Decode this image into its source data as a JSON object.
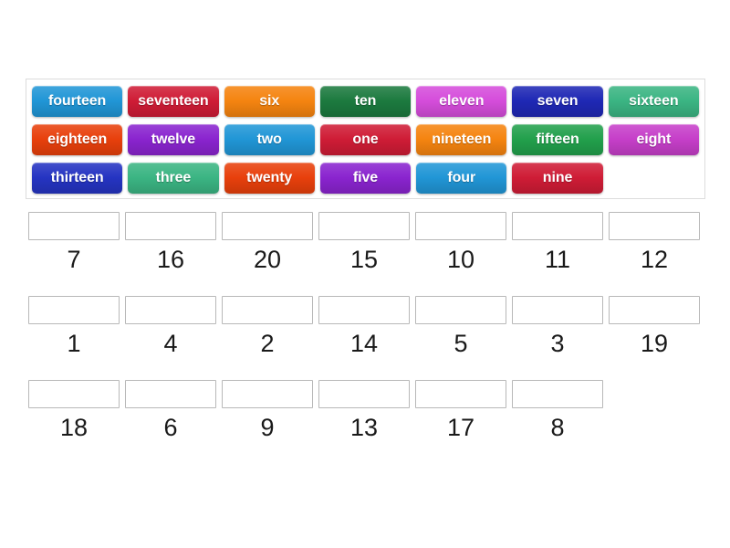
{
  "activity": {
    "type": "match-up-word-to-number",
    "title": "Number words matching activity"
  },
  "tile_bank": {
    "name": "word-tile-bank",
    "rows": [
      [
        {
          "label": "fourteen",
          "color": "#2196d6"
        },
        {
          "label": "seventeen",
          "color": "#cf1c36"
        },
        {
          "label": "six",
          "color": "#f58410"
        },
        {
          "label": "ten",
          "color": "#1c7a3f"
        },
        {
          "label": "eleven",
          "color": "#d54ddb"
        },
        {
          "label": "seven",
          "color": "#1f28b5"
        },
        {
          "label": "sixteen",
          "color": "#3bb583"
        }
      ],
      [
        {
          "label": "eighteen",
          "color": "#e8400c"
        },
        {
          "label": "twelve",
          "color": "#8a24cf"
        },
        {
          "label": "two",
          "color": "#2196d6"
        },
        {
          "label": "one",
          "color": "#cf1c36"
        },
        {
          "label": "nineteen",
          "color": "#f58410"
        },
        {
          "label": "fifteen",
          "color": "#22a04c"
        },
        {
          "label": "eight",
          "color": "#c63fc9"
        }
      ],
      [
        {
          "label": "thirteen",
          "color": "#2534c2"
        },
        {
          "label": "three",
          "color": "#3bb583"
        },
        {
          "label": "twenty",
          "color": "#e8400c"
        },
        {
          "label": "five",
          "color": "#8a24cf"
        },
        {
          "label": "four",
          "color": "#2196d6"
        },
        {
          "label": "nine",
          "color": "#cf1c36"
        },
        {
          "label": "",
          "color": "",
          "empty": true
        }
      ]
    ]
  },
  "answer_area": {
    "name": "numeral-answer-rows",
    "drop_zone_value": "",
    "rows": [
      {
        "labels": [
          "7",
          "16",
          "20",
          "15",
          "10",
          "11",
          "12"
        ]
      },
      {
        "labels": [
          "1",
          "4",
          "2",
          "14",
          "5",
          "3",
          "19"
        ]
      },
      {
        "labels": [
          "18",
          "6",
          "9",
          "13",
          "17",
          "8"
        ]
      }
    ]
  },
  "style": {
    "page_background": "#ffffff",
    "bank_border": "#dcdcdc",
    "dropbox_border": "#b8b8b8",
    "label_color": "#1a1a1a",
    "tile_text_color": "#ffffff"
  }
}
